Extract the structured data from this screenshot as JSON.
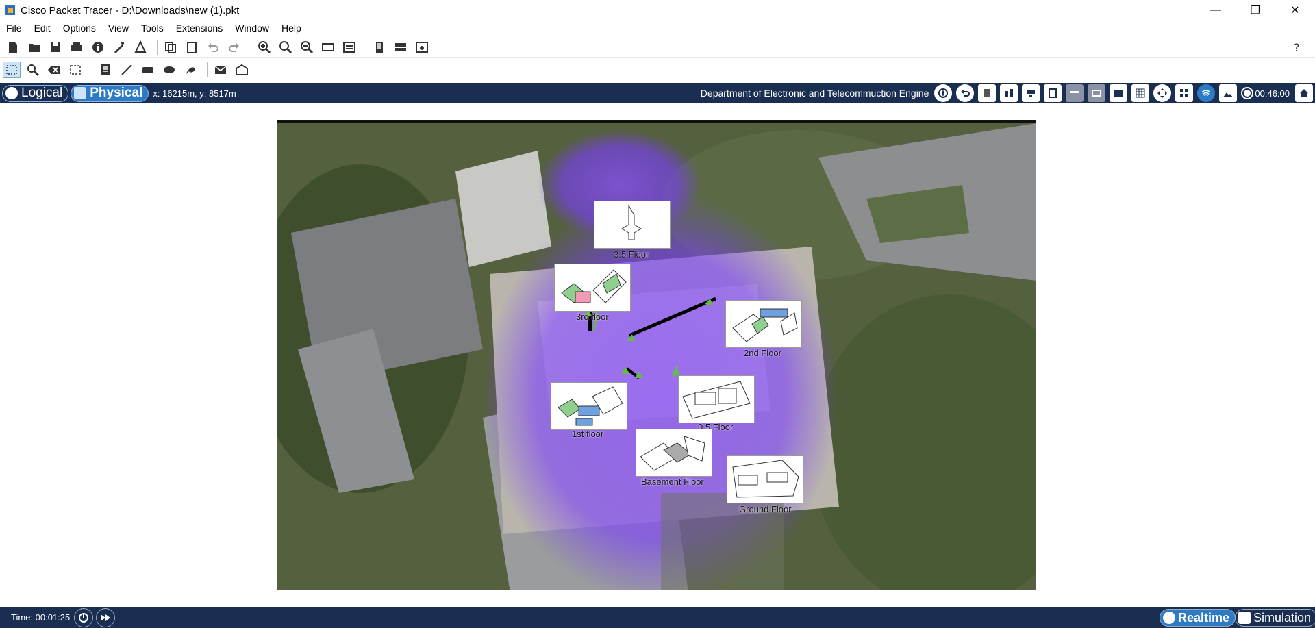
{
  "window": {
    "title": "Cisco Packet Tracer - D:\\Downloads\\new (1).pkt",
    "minimize": "—",
    "maximize": "❐",
    "close": "✕"
  },
  "menu": [
    "File",
    "Edit",
    "Options",
    "View",
    "Tools",
    "Extensions",
    "Window",
    "Help"
  ],
  "toolbar1": [
    "new-icon",
    "open-icon",
    "save-icon",
    "print-icon",
    "info-icon",
    "wizard-icon",
    "network-icon",
    "copy-icon",
    "paste-icon",
    "undo-icon",
    "redo-icon",
    "zoom-in-icon",
    "zoom-reset-icon",
    "zoom-out-icon",
    "rectangle-view-icon",
    "palette-icon",
    "custom-device-icon",
    "viewport-icon",
    "help-icon"
  ],
  "toolbar2": [
    "select-icon",
    "inspect-icon",
    "delete-icon",
    "resize-icon",
    "note-icon",
    "line-icon",
    "rectangle-icon",
    "ellipse-icon",
    "freeform-icon",
    "add-pdu-icon",
    "add-complex-pdu-icon"
  ],
  "nav": {
    "logical": "Logical",
    "physical": "Physical",
    "coords": "x: 16215m, y: 8517m",
    "location": "Department of Electronic and Telecommuction Engine",
    "clock": "00:46:00"
  },
  "floors": [
    {
      "label": "3.5 Floor"
    },
    {
      "label": "3rd floor"
    },
    {
      "label": "2nd Floor"
    },
    {
      "label": "1st floor"
    },
    {
      "label": "0.5 Floor"
    },
    {
      "label": "Basement Floor"
    },
    {
      "label": "Ground Floor"
    }
  ],
  "bottom": {
    "time": "Time: 00:01:25",
    "realtime": "Realtime",
    "simulation": "Simulation"
  },
  "colors": {
    "nav_bg": "#1a2e52",
    "active_pill": "#2c7bc4",
    "wireless_glow": "#7a3cff",
    "link_green": "#66bb44"
  }
}
